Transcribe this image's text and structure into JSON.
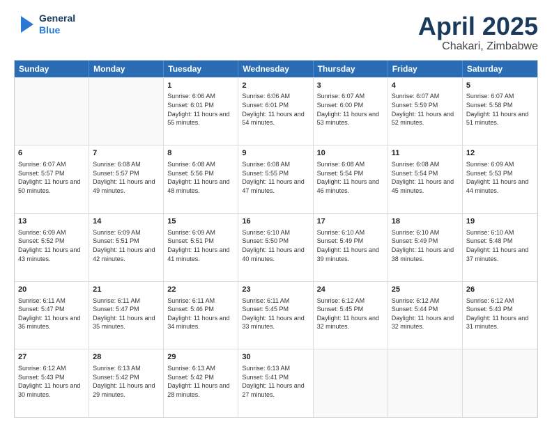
{
  "header": {
    "logo_general": "General",
    "logo_blue": "Blue",
    "title": "April 2025",
    "location": "Chakari, Zimbabwe"
  },
  "calendar": {
    "days_of_week": [
      "Sunday",
      "Monday",
      "Tuesday",
      "Wednesday",
      "Thursday",
      "Friday",
      "Saturday"
    ],
    "weeks": [
      [
        {
          "day": "",
          "sunrise": "",
          "sunset": "",
          "daylight": ""
        },
        {
          "day": "",
          "sunrise": "",
          "sunset": "",
          "daylight": ""
        },
        {
          "day": "1",
          "sunrise": "Sunrise: 6:06 AM",
          "sunset": "Sunset: 6:01 PM",
          "daylight": "Daylight: 11 hours and 55 minutes."
        },
        {
          "day": "2",
          "sunrise": "Sunrise: 6:06 AM",
          "sunset": "Sunset: 6:01 PM",
          "daylight": "Daylight: 11 hours and 54 minutes."
        },
        {
          "day": "3",
          "sunrise": "Sunrise: 6:07 AM",
          "sunset": "Sunset: 6:00 PM",
          "daylight": "Daylight: 11 hours and 53 minutes."
        },
        {
          "day": "4",
          "sunrise": "Sunrise: 6:07 AM",
          "sunset": "Sunset: 5:59 PM",
          "daylight": "Daylight: 11 hours and 52 minutes."
        },
        {
          "day": "5",
          "sunrise": "Sunrise: 6:07 AM",
          "sunset": "Sunset: 5:58 PM",
          "daylight": "Daylight: 11 hours and 51 minutes."
        }
      ],
      [
        {
          "day": "6",
          "sunrise": "Sunrise: 6:07 AM",
          "sunset": "Sunset: 5:57 PM",
          "daylight": "Daylight: 11 hours and 50 minutes."
        },
        {
          "day": "7",
          "sunrise": "Sunrise: 6:08 AM",
          "sunset": "Sunset: 5:57 PM",
          "daylight": "Daylight: 11 hours and 49 minutes."
        },
        {
          "day": "8",
          "sunrise": "Sunrise: 6:08 AM",
          "sunset": "Sunset: 5:56 PM",
          "daylight": "Daylight: 11 hours and 48 minutes."
        },
        {
          "day": "9",
          "sunrise": "Sunrise: 6:08 AM",
          "sunset": "Sunset: 5:55 PM",
          "daylight": "Daylight: 11 hours and 47 minutes."
        },
        {
          "day": "10",
          "sunrise": "Sunrise: 6:08 AM",
          "sunset": "Sunset: 5:54 PM",
          "daylight": "Daylight: 11 hours and 46 minutes."
        },
        {
          "day": "11",
          "sunrise": "Sunrise: 6:08 AM",
          "sunset": "Sunset: 5:54 PM",
          "daylight": "Daylight: 11 hours and 45 minutes."
        },
        {
          "day": "12",
          "sunrise": "Sunrise: 6:09 AM",
          "sunset": "Sunset: 5:53 PM",
          "daylight": "Daylight: 11 hours and 44 minutes."
        }
      ],
      [
        {
          "day": "13",
          "sunrise": "Sunrise: 6:09 AM",
          "sunset": "Sunset: 5:52 PM",
          "daylight": "Daylight: 11 hours and 43 minutes."
        },
        {
          "day": "14",
          "sunrise": "Sunrise: 6:09 AM",
          "sunset": "Sunset: 5:51 PM",
          "daylight": "Daylight: 11 hours and 42 minutes."
        },
        {
          "day": "15",
          "sunrise": "Sunrise: 6:09 AM",
          "sunset": "Sunset: 5:51 PM",
          "daylight": "Daylight: 11 hours and 41 minutes."
        },
        {
          "day": "16",
          "sunrise": "Sunrise: 6:10 AM",
          "sunset": "Sunset: 5:50 PM",
          "daylight": "Daylight: 11 hours and 40 minutes."
        },
        {
          "day": "17",
          "sunrise": "Sunrise: 6:10 AM",
          "sunset": "Sunset: 5:49 PM",
          "daylight": "Daylight: 11 hours and 39 minutes."
        },
        {
          "day": "18",
          "sunrise": "Sunrise: 6:10 AM",
          "sunset": "Sunset: 5:49 PM",
          "daylight": "Daylight: 11 hours and 38 minutes."
        },
        {
          "day": "19",
          "sunrise": "Sunrise: 6:10 AM",
          "sunset": "Sunset: 5:48 PM",
          "daylight": "Daylight: 11 hours and 37 minutes."
        }
      ],
      [
        {
          "day": "20",
          "sunrise": "Sunrise: 6:11 AM",
          "sunset": "Sunset: 5:47 PM",
          "daylight": "Daylight: 11 hours and 36 minutes."
        },
        {
          "day": "21",
          "sunrise": "Sunrise: 6:11 AM",
          "sunset": "Sunset: 5:47 PM",
          "daylight": "Daylight: 11 hours and 35 minutes."
        },
        {
          "day": "22",
          "sunrise": "Sunrise: 6:11 AM",
          "sunset": "Sunset: 5:46 PM",
          "daylight": "Daylight: 11 hours and 34 minutes."
        },
        {
          "day": "23",
          "sunrise": "Sunrise: 6:11 AM",
          "sunset": "Sunset: 5:45 PM",
          "daylight": "Daylight: 11 hours and 33 minutes."
        },
        {
          "day": "24",
          "sunrise": "Sunrise: 6:12 AM",
          "sunset": "Sunset: 5:45 PM",
          "daylight": "Daylight: 11 hours and 32 minutes."
        },
        {
          "day": "25",
          "sunrise": "Sunrise: 6:12 AM",
          "sunset": "Sunset: 5:44 PM",
          "daylight": "Daylight: 11 hours and 32 minutes."
        },
        {
          "day": "26",
          "sunrise": "Sunrise: 6:12 AM",
          "sunset": "Sunset: 5:43 PM",
          "daylight": "Daylight: 11 hours and 31 minutes."
        }
      ],
      [
        {
          "day": "27",
          "sunrise": "Sunrise: 6:12 AM",
          "sunset": "Sunset: 5:43 PM",
          "daylight": "Daylight: 11 hours and 30 minutes."
        },
        {
          "day": "28",
          "sunrise": "Sunrise: 6:13 AM",
          "sunset": "Sunset: 5:42 PM",
          "daylight": "Daylight: 11 hours and 29 minutes."
        },
        {
          "day": "29",
          "sunrise": "Sunrise: 6:13 AM",
          "sunset": "Sunset: 5:42 PM",
          "daylight": "Daylight: 11 hours and 28 minutes."
        },
        {
          "day": "30",
          "sunrise": "Sunrise: 6:13 AM",
          "sunset": "Sunset: 5:41 PM",
          "daylight": "Daylight: 11 hours and 27 minutes."
        },
        {
          "day": "",
          "sunrise": "",
          "sunset": "",
          "daylight": ""
        },
        {
          "day": "",
          "sunrise": "",
          "sunset": "",
          "daylight": ""
        },
        {
          "day": "",
          "sunrise": "",
          "sunset": "",
          "daylight": ""
        }
      ]
    ]
  }
}
